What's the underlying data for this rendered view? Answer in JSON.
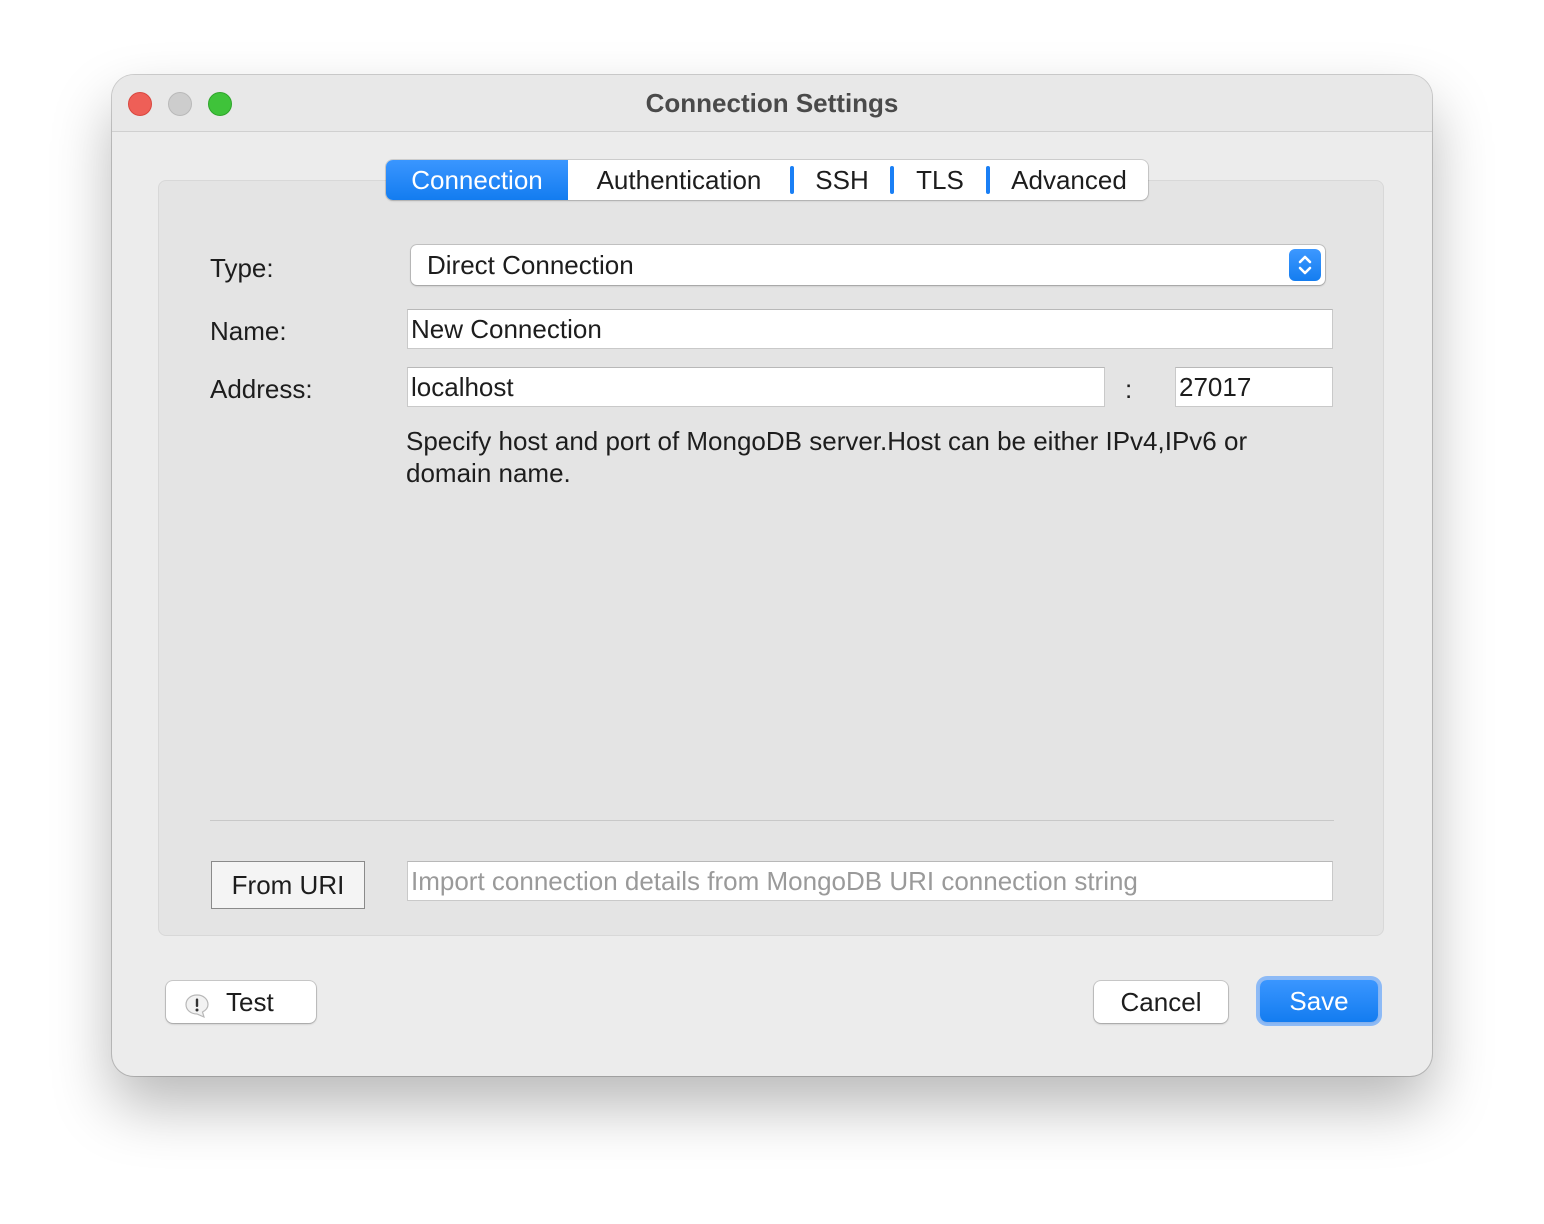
{
  "window": {
    "title": "Connection Settings"
  },
  "tabs": [
    {
      "label": "Connection",
      "active": true
    },
    {
      "label": "Authentication",
      "active": false
    },
    {
      "label": "SSH",
      "active": false
    },
    {
      "label": "TLS",
      "active": false
    },
    {
      "label": "Advanced",
      "active": false
    }
  ],
  "form": {
    "type_label": "Type:",
    "type_value": "Direct Connection",
    "name_label": "Name:",
    "name_value": "New Connection",
    "address_label": "Address:",
    "host_value": "localhost",
    "port_separator": ":",
    "port_value": "27017",
    "hint": "Specify host and port of MongoDB server.Host can be either IPv4,IPv6 or domain name."
  },
  "uri": {
    "button_label": "From URI",
    "placeholder": "Import connection details from MongoDB URI connection string"
  },
  "footer": {
    "test_label": "Test",
    "cancel_label": "Cancel",
    "save_label": "Save"
  },
  "colors": {
    "accent": "#1a82f7",
    "close": "#ee5f57",
    "minimize": "#cdcdcd",
    "maximize": "#3fc33a"
  },
  "icons": {
    "select_arrows": "chevron-up-down-icon",
    "test": "exclamation-bubble-icon"
  }
}
